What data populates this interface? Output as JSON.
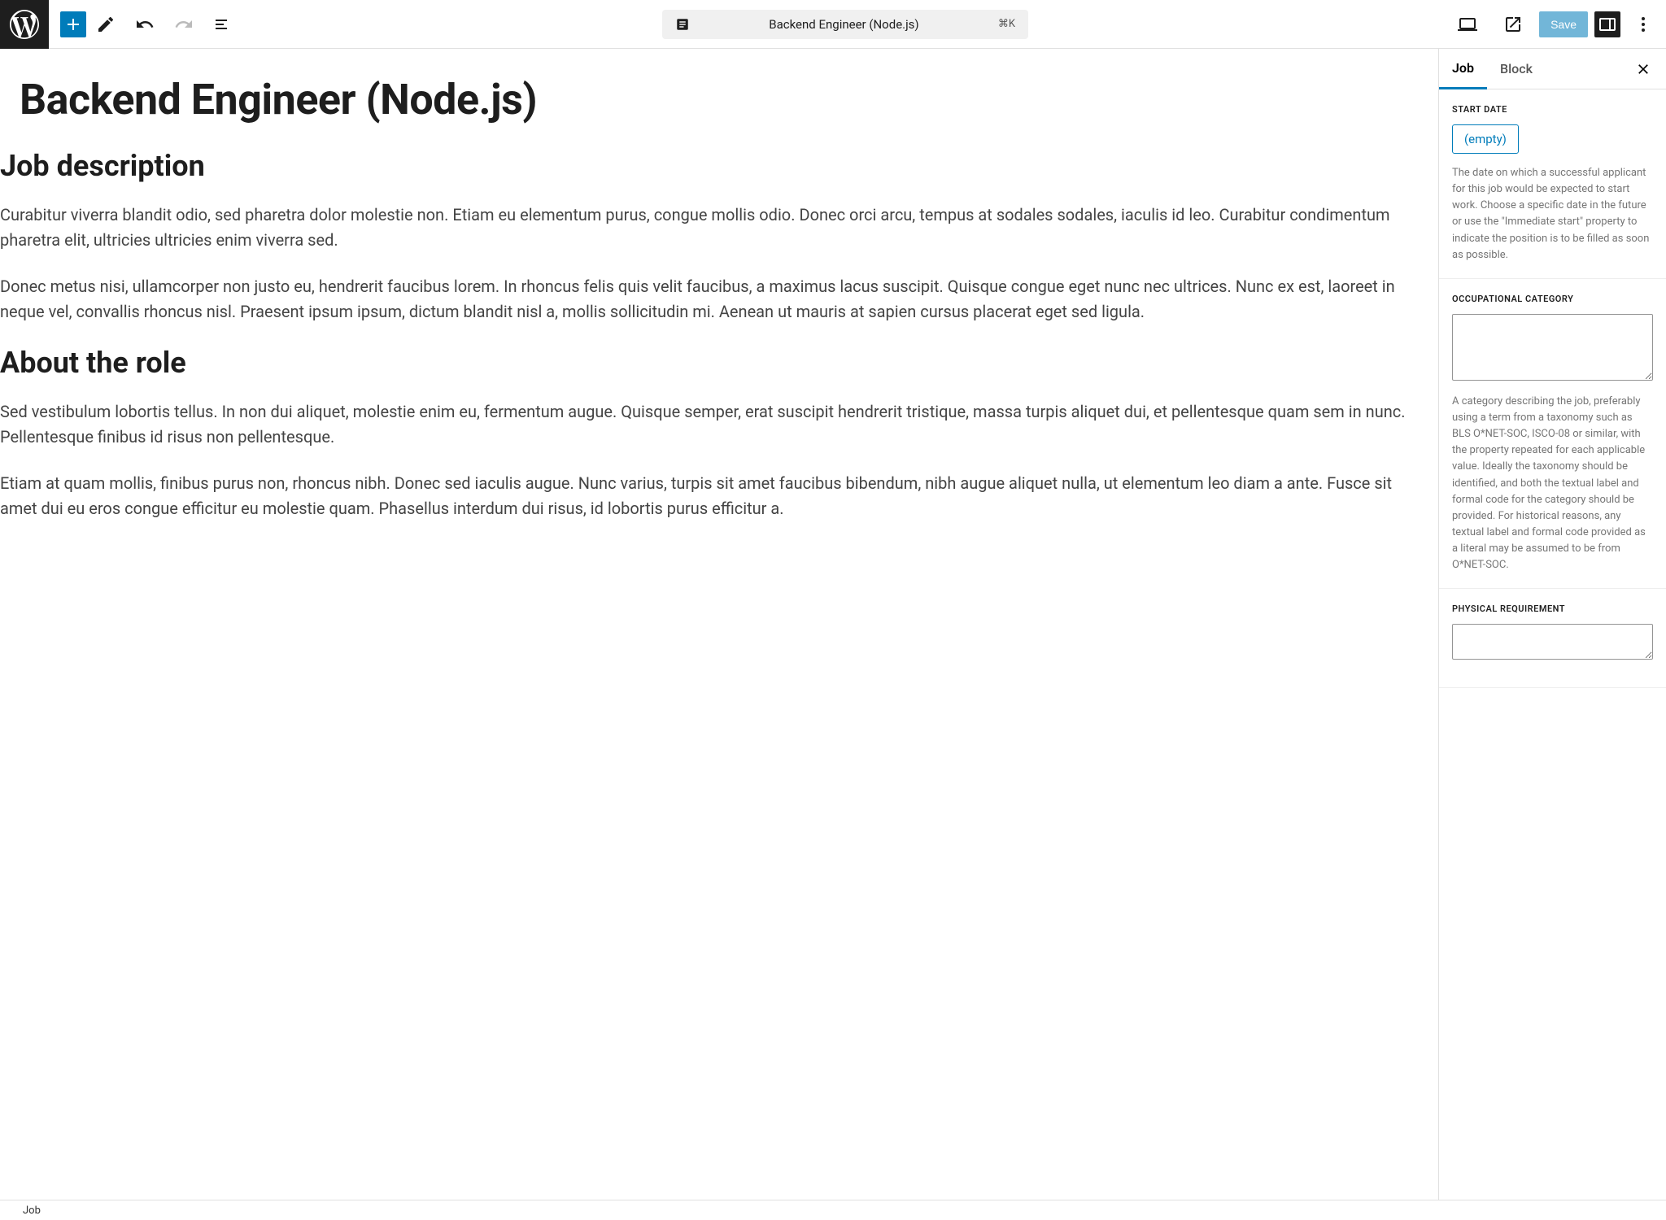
{
  "topbar": {
    "doc_title": "Backend Engineer (Node.js)",
    "shortcut": "⌘K",
    "save_label": "Save"
  },
  "editor": {
    "post_title": "Backend Engineer (Node.js)",
    "h2_1": "Job description",
    "p1": "Curabitur viverra blandit odio, sed pharetra dolor molestie non. Etiam eu elementum purus, congue mollis odio. Donec orci arcu, tempus at sodales sodales, iaculis id leo. Curabitur condimentum pharetra elit, ultricies ultricies enim viverra sed.",
    "p2": "Donec metus nisi, ullamcorper non justo eu, hendrerit faucibus lorem. In rhoncus felis quis velit faucibus, a maximus lacus suscipit. Quisque congue eget nunc nec ultrices. Nunc ex est, laoreet in neque vel, convallis rhoncus nisl. Praesent ipsum ipsum, dictum blandit nisl a, mollis sollicitudin mi. Aenean ut mauris at sapien cursus placerat eget sed ligula.",
    "h2_2": "About the role",
    "p3": "Sed vestibulum lobortis tellus. In non dui aliquet, molestie enim eu, fermentum augue. Quisque semper, erat suscipit hendrerit tristique, massa turpis aliquet dui, et pellentesque quam sem in nunc. Pellentesque finibus id risus non pellentesque.",
    "p4": "Etiam at quam mollis, finibus purus non, rhoncus nibh. Donec sed iaculis augue. Nunc varius, turpis sit amet faucibus bibendum, nibh augue aliquet nulla, ut elementum leo diam a ante. Fusce sit amet dui eu eros congue efficitur eu molestie quam. Phasellus interdum dui risus, id lobortis purus efficitur a."
  },
  "sidebar": {
    "tabs": {
      "job": "Job",
      "block": "Block"
    },
    "start_date": {
      "label": "START DATE",
      "empty": "(empty)",
      "description": "The date on which a successful applicant for this job would be expected to start work. Choose a specific date in the future or use the \"Immediate start\" property to indicate the position is to be filled as soon as possible."
    },
    "occupational_category": {
      "label": "OCCUPATIONAL CATEGORY",
      "description": "A category describing the job, preferably using a term from a taxonomy such as BLS O*NET-SOC, ISCO-08 or similar, with the property repeated for each applicable value. Ideally the taxonomy should be identified, and both the textual label and formal code for the category should be provided. For historical reasons, any textual label and formal code provided as a literal may be assumed to be from O*NET-SOC."
    },
    "physical_requirement": {
      "label": "PHYSICAL REQUIREMENT"
    }
  },
  "footer": {
    "breadcrumb": "Job"
  }
}
